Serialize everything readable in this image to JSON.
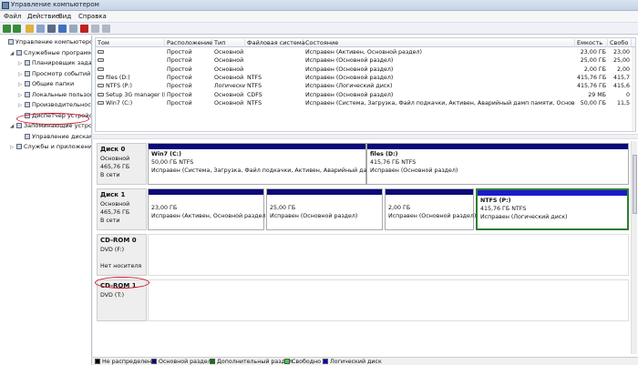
{
  "window": {
    "title": "Управление компьютером"
  },
  "menu": [
    "Файл",
    "Действие",
    "Вид",
    "Справка"
  ],
  "tree": [
    {
      "label": "Управление компьютером (л",
      "indent": 0,
      "exp": "",
      "icon": "computer-icon"
    },
    {
      "label": "Служебные программы",
      "indent": 1,
      "exp": "◢",
      "icon": "tools-icon"
    },
    {
      "label": "Планировщик заданий",
      "indent": 2,
      "exp": "▷",
      "icon": "clock-icon"
    },
    {
      "label": "Просмотр событий",
      "indent": 2,
      "exp": "▷",
      "icon": "event-viewer-icon"
    },
    {
      "label": "Общие папки",
      "indent": 2,
      "exp": "▷",
      "icon": "shared-folder-icon"
    },
    {
      "label": "Локальные пользовате",
      "indent": 2,
      "exp": "▷",
      "icon": "users-icon"
    },
    {
      "label": "Производительность",
      "indent": 2,
      "exp": "▷",
      "icon": "performance-icon"
    },
    {
      "label": "Диспетчер устройств",
      "indent": 2,
      "exp": "",
      "icon": "device-manager-icon"
    },
    {
      "label": "Запоминающие устройст",
      "indent": 1,
      "exp": "◢",
      "icon": "storage-icon"
    },
    {
      "label": "Управление дисками",
      "indent": 2,
      "exp": "",
      "icon": "disk-management-icon"
    },
    {
      "label": "Службы и приложения",
      "indent": 1,
      "exp": "▷",
      "icon": "services-icon"
    }
  ],
  "table": {
    "headers": [
      "Том",
      "Расположение",
      "Тип",
      "Файловая система",
      "Состояние",
      "Емкость",
      "Свобо"
    ],
    "rows": [
      [
        "",
        "Простой",
        "Основной",
        "",
        "Исправен (Активен, Основной раздел)",
        "23,00 ГБ",
        "23,00"
      ],
      [
        "",
        "Простой",
        "Основной",
        "",
        "Исправен (Основной раздел)",
        "25,00 ГБ",
        "25,00"
      ],
      [
        "",
        "Простой",
        "Основной",
        "",
        "Исправен (Основной раздел)",
        "2,00 ГБ",
        "2,00"
      ],
      [
        "files (D:)",
        "Простой",
        "Основной",
        "NTFS",
        "Исправен (Основной раздел)",
        "415,76 ГБ",
        "415,7"
      ],
      [
        "NTFS (P:)",
        "Простой",
        "Логический",
        "NTFS",
        "Исправен (Логический диск)",
        "415,76 ГБ",
        "415,6"
      ],
      [
        "Setup 3G manager (E:)",
        "Простой",
        "Основной",
        "CDFS",
        "Исправен (Основной раздел)",
        "29 МБ",
        "0"
      ],
      [
        "Win7 (C:)",
        "Простой",
        "Основной",
        "NTFS",
        "Исправен (Система, Загрузка, Файл подкачки, Активен, Аварийный дамп памяти, Основной раздел)",
        "50,00 ГБ",
        "11,5"
      ]
    ]
  },
  "disks": {
    "disk0": {
      "name": "Диск 0",
      "type": "Основной",
      "size": "465,76 ГБ",
      "status": "В сети",
      "parts": [
        {
          "title": "Win7  (C:)",
          "size": "50,00 ГБ NTFS",
          "status": "Исправен (Система, Загрузка, Файл подкачки, Активен, Аварийный дамп памя"
        },
        {
          "title": "files  (D:)",
          "size": "415,76 ГБ NTFS",
          "status": "Исправен (Основной раздел)"
        }
      ]
    },
    "disk1": {
      "name": "Диск 1",
      "type": "Основной",
      "size": "465,76 ГБ",
      "status": "В сети",
      "parts": [
        {
          "title": "",
          "size": "23,00 ГБ",
          "status": "Исправен (Активен, Основной раздел)"
        },
        {
          "title": "",
          "size": "25,00 ГБ",
          "status": "Исправен (Основной раздел)"
        },
        {
          "title": "",
          "size": "2,00 ГБ",
          "status": "Исправен (Основной раздел)"
        },
        {
          "title": "NTFS  (P:)",
          "size": "415,76 ГБ NTFS",
          "status": "Исправен (Логический диск)"
        }
      ]
    },
    "cd0": {
      "name": "CD-ROM 0",
      "type": "DVD (F:)",
      "status": "Нет носителя"
    },
    "cd1": {
      "name": "CD-ROM 1",
      "type": "DVD (T:)"
    }
  },
  "legend": [
    {
      "label": "Не распределен",
      "color": "#000000"
    },
    {
      "label": "Основной раздел",
      "color": "#00008b"
    },
    {
      "label": "Дополнительный раздел",
      "color": "#007a00"
    },
    {
      "label": "Свободно",
      "color": "#44d044"
    },
    {
      "label": "Логический диск",
      "color": "#0000cc"
    }
  ],
  "colors": {
    "primary_bar": "#0a0a7a",
    "logical_bar": "#1a1acc",
    "selection": "#2e7d32",
    "annotation": "#d0112b"
  }
}
